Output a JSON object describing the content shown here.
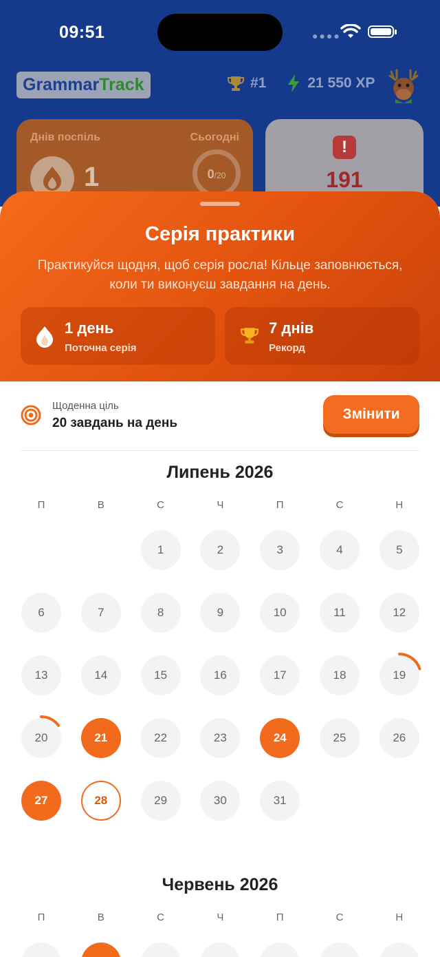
{
  "status_bar": {
    "time": "09:51"
  },
  "header": {
    "logo_part1": "Grammar",
    "logo_part2": "Track",
    "rank": "#1",
    "xp": "21 550 XP"
  },
  "streak_card": {
    "label_days": "Днів поспіль",
    "label_today": "Сьогодні",
    "days": "1",
    "today_done": "0",
    "today_total": "/20"
  },
  "errors_card": {
    "count": "191"
  },
  "sheet": {
    "title": "Серія практики",
    "description": "Практикуйся щодня, щоб серія росла! Кільце заповнюється, коли ти виконуєш завдання на день.",
    "current": {
      "value": "1 день",
      "label": "Поточна серія"
    },
    "record": {
      "value": "7 днів",
      "label": "Рекорд"
    }
  },
  "goal": {
    "label": "Щоденна ціль",
    "value": "20 завдань на день",
    "button": "Змінити"
  },
  "calendar": {
    "weekdays": [
      "П",
      "В",
      "С",
      "Ч",
      "П",
      "С",
      "Н"
    ],
    "months": [
      {
        "title": "Липень 2026",
        "first_weekday_index": 2,
        "days": 31,
        "completed_days": [
          21,
          24,
          27
        ],
        "today": 28,
        "partial_days": [
          {
            "day": 19,
            "progress": 0.2
          },
          {
            "day": 20,
            "progress": 0.15
          }
        ]
      },
      {
        "title": "Червень 2026",
        "first_weekday_index": 0,
        "completed_days": [
          2
        ]
      }
    ]
  },
  "colors": {
    "accent": "#f26a1c",
    "header_bg": "#153a8c",
    "day_bg": "#f2f3f5"
  }
}
